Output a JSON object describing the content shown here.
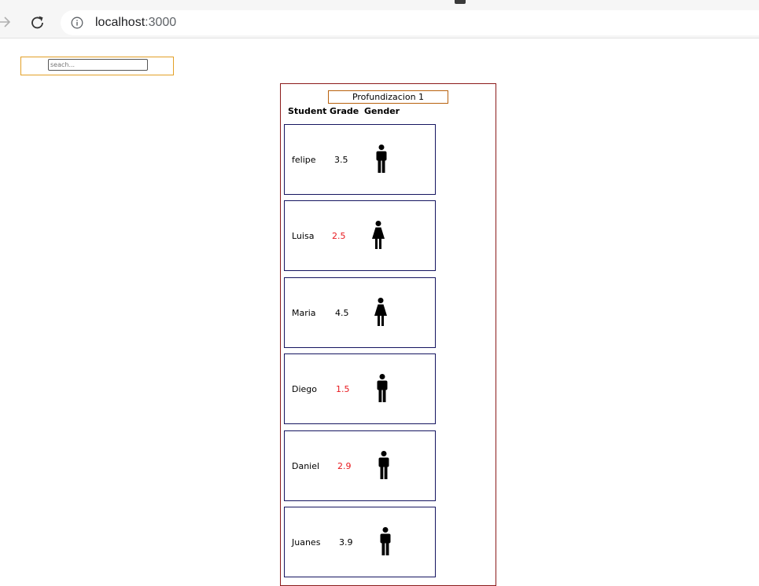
{
  "browser": {
    "url_host": "localhost",
    "url_port": ":3000"
  },
  "search": {
    "placeholder": "seach..."
  },
  "course": {
    "title": "Profundizacion 1"
  },
  "table": {
    "headers": {
      "student": "Student",
      "grade": "Grade",
      "gender": "Gender"
    },
    "pass_color": "#000000",
    "fail_color": "#e8181e",
    "rows": [
      {
        "name": "felipe",
        "grade": "3.5",
        "gender": "male-icon"
      },
      {
        "name": "Luisa",
        "grade": "2.5",
        "gender": "female-icon"
      },
      {
        "name": "Maria",
        "grade": "4.5",
        "gender": "female-icon"
      },
      {
        "name": "Diego",
        "grade": "1.5",
        "gender": "male-icon"
      },
      {
        "name": "Daniel",
        "grade": "2.9",
        "gender": "male-icon"
      },
      {
        "name": "Juanes",
        "grade": "3.9",
        "gender": "male-icon"
      }
    ]
  }
}
